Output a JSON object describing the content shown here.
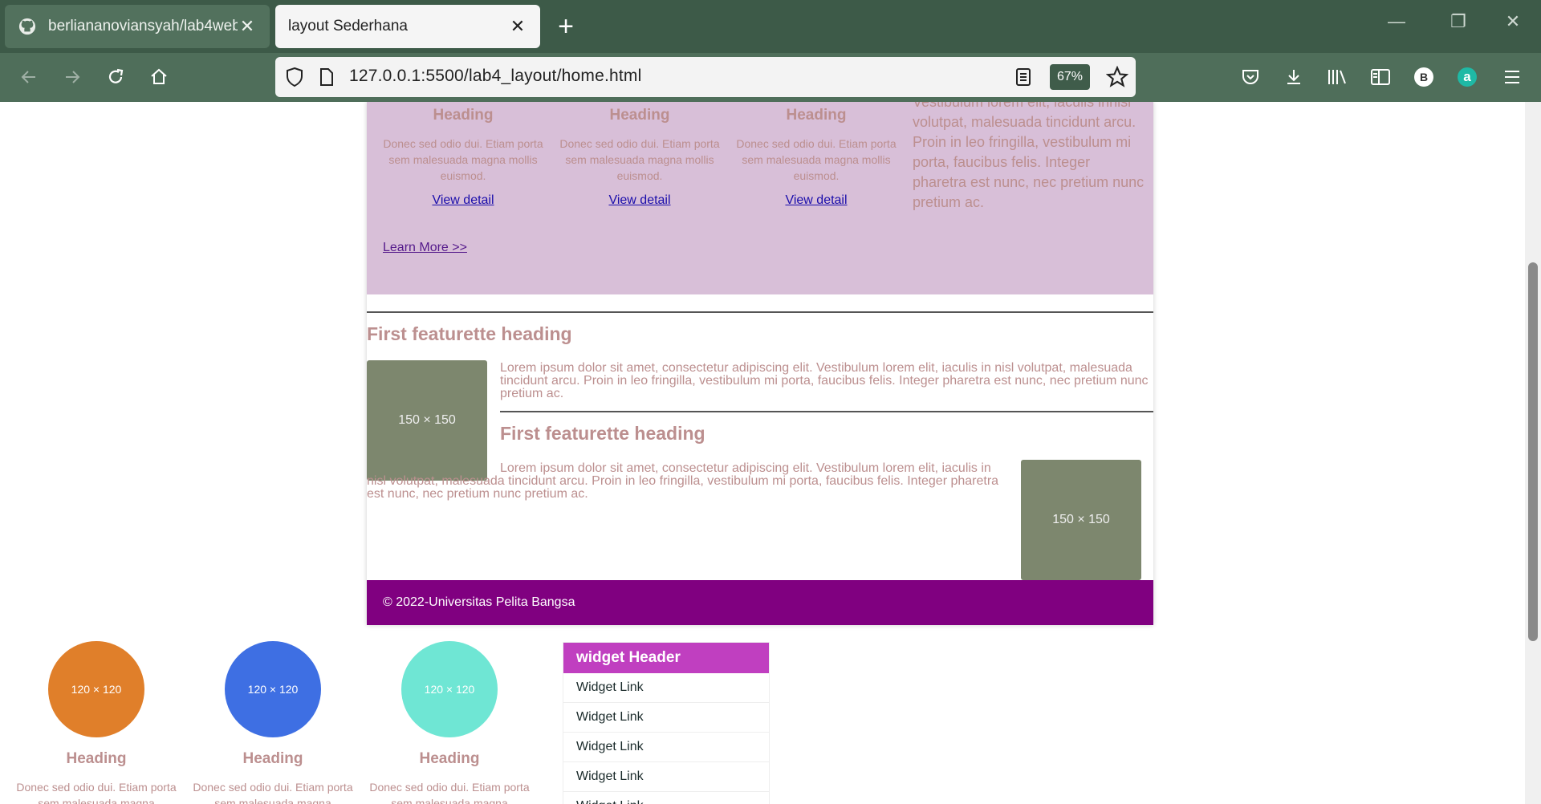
{
  "browser": {
    "tabs": [
      {
        "title": "berliananoviansyah/lab4web",
        "active": false,
        "icon": "github-icon"
      },
      {
        "title": "layout Sederhana",
        "active": true,
        "icon": ""
      }
    ],
    "new_tab": "+",
    "url": "127.0.0.1:5500/lab4_layout/home.html",
    "zoom": "67%",
    "account_badge": "B",
    "extension_badge": "a"
  },
  "page": {
    "hero": {
      "columns": [
        {
          "heading": "Heading",
          "text": "Donec sed odio dui. Etiam porta sem malesuada magna mollis euismod.",
          "link": "View detail"
        },
        {
          "heading": "Heading",
          "text": "Donec sed odio dui. Etiam porta sem malesuada magna mollis euismod.",
          "link": "View detail"
        },
        {
          "heading": "Heading",
          "text": "Donec sed odio dui. Etiam porta sem malesuada magna mollis euismod.",
          "link": "View detail"
        }
      ],
      "side_text": "Vestibulum lorem elit, iaculis innisl volutpat, malesuada tincidunt arcu. Proin in leo fringilla, vestibulum mi porta, faucibus felis. Integer pharetra est nunc, nec pretium nunc pretium ac.",
      "learn_more": "Learn More >>"
    },
    "featurettes": [
      {
        "heading": "First featurette heading",
        "text": "Lorem ipsum dolor sit amet, consectetur adipiscing elit. Vestibulum lorem elit, iaculis in nisl volutpat, malesuada tincidunt arcu. Proin in leo fringilla, vestibulum mi porta, faucibus felis. Integer pharetra est nunc, nec pretium nunc pretium ac.",
        "image": "150 × 150"
      },
      {
        "heading": "First featurette heading",
        "text": "Lorem ipsum dolor sit amet, consectetur adipiscing elit. Vestibulum lorem elit, iaculis in nisl volutpat, malesuada tincidunt arcu. Proin in leo fringilla, vestibulum mi porta, faucibus felis. Integer pharetra est nunc, nec pretium nunc pretium ac.",
        "image": "150 × 150"
      }
    ],
    "footer": "© 2022-Universitas Pelita Bangsa",
    "bottom_columns": [
      {
        "image": "120 × 120",
        "color": "#e07f2a",
        "heading": "Heading",
        "text": "Donec sed odio dui. Etiam porta sem malesuada magna"
      },
      {
        "image": "120 × 120",
        "color": "#3e6fe3",
        "heading": "Heading",
        "text": "Donec sed odio dui. Etiam porta sem malesuada magna"
      },
      {
        "image": "120 × 120",
        "color": "#6fe6d4",
        "heading": "Heading",
        "text": "Donec sed odio dui. Etiam porta sem malesuada magna"
      }
    ],
    "widget": {
      "header": "widget Header",
      "links": [
        "Widget Link",
        "Widget Link",
        "Widget Link",
        "Widget Link",
        "Widget Link"
      ]
    }
  }
}
